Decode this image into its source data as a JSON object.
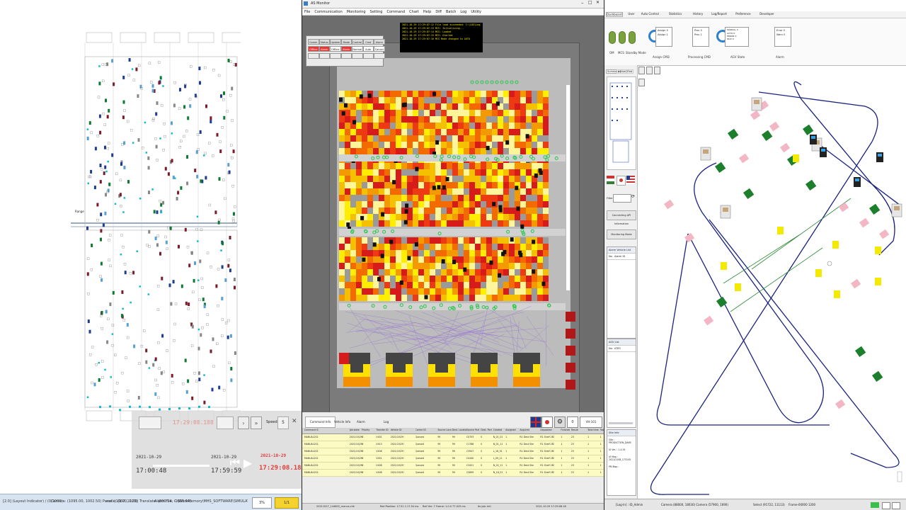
{
  "left_viewer": {
    "zoom_label": "Range",
    "playback": {
      "date_start": "2021-10-29",
      "time_start": "17:00:48",
      "date_end": "2021-10-29",
      "time_end": "17:59:59",
      "current_date": "2021-10-29",
      "current_time": "17:29:08.188",
      "speed_value": "5"
    },
    "status": {
      "item1": "[2.0] (Layout Indicator) / (0/1000)",
      "item2": "Camera: (1095.00, 1002.50) Panel: (1067, 1020)",
      "item3": "scale: (1.00, 1.00)  Translate: (800.14, -1650.04)",
      "item4": "Alarm File: C:\\WorkMemory\\MHS_SOFTWARE\\SIMULATOR\\MAP\\MAP1001_ESS\\MAP\\MAP1001_570.rdjmap",
      "zoom_pct": "3%",
      "page": "1/1"
    }
  },
  "monitor": {
    "title": "AS Monitor",
    "menu": [
      "File",
      "Communication",
      "Monitoring",
      "Setting",
      "Command",
      "Chart",
      "Help",
      "Diff",
      "Batch",
      "Log",
      "Utility"
    ],
    "log_lines": [
      "2021-10-29 17:29:07:12  File load succeeded: C:\\LOG\\Log20211029_1751_mcsscript",
      "2021-10-29 17:29:07:13  MCS: Initializing...",
      "2021-10-29 17:29:07:14  MCS: Loaded",
      "2021-10-29 17:29:07:15  MCS: Started",
      "2021-10-29 17:29:07:16  MCS Mode changed to AUTO"
    ],
    "state_headers": [
      "Comm",
      "Status",
      "Update",
      "Mode",
      "Control",
      "Cmd",
      "Alarm"
    ],
    "state_values": [
      "Offline",
      "Alarm",
      "Offline",
      "Alarm",
      "Normal",
      "Auto",
      "Cancel"
    ],
    "tabs": [
      "Command Info",
      "Vehicle Info",
      "Alarm",
      "Log"
    ],
    "table": {
      "columns": [
        "Command ID",
        "Job state",
        "Priority",
        "Transfer ID",
        "Vehicle ID",
        "Carrier ID",
        "Source Location",
        "Dest. Location",
        "Source Port",
        "Dest. Port",
        "Created",
        "Assigned",
        "Acquired",
        "Deposited",
        "Finished",
        "Result",
        "Total time",
        "Replace"
      ],
      "rows": [
        [
          "MANUAL20211029_001",
          "2021/10/29 17:28",
          "0",
          "V401",
          "2021/10/29 17:28",
          "Queued",
          "99",
          "99",
          "C0753",
          "0",
          "N_01_01",
          "1",
          "R1 Dest Shelf",
          "R1 Shelf 2B3",
          "1",
          "23",
          "1",
          "1"
        ],
        [
          "MANUAL20211029_002",
          "2021/10/29 17:28",
          "0",
          "V413",
          "2021/10/29 17:28",
          "Queued",
          "99",
          "99",
          "C1788",
          "0",
          "N_01_11",
          "1",
          "R1 Dest Shelf",
          "R1 Shelf 2B3",
          "1",
          "23",
          "1",
          "1"
        ],
        [
          "MANUAL20211029_003",
          "2021/10/29 17:28",
          "0",
          "V406",
          "2021/10/29 17:28",
          "Queued",
          "99",
          "99",
          "C3947",
          "0",
          "L_18_01",
          "1",
          "R1 Dest Shelf",
          "R1 Shelf 2B3",
          "1",
          "23",
          "1",
          "1"
        ],
        [
          "MANUAL20211029_004",
          "2021/10/29 17:28",
          "0",
          "V451",
          "2021/10/29 17:28",
          "Queued",
          "99",
          "99",
          "C0440",
          "0",
          "L_09_11",
          "1",
          "R1 Dest Shelf",
          "R1 Shelf 2B3",
          "1",
          "23",
          "1",
          "1"
        ],
        [
          "MANUAL20211029_005",
          "2021/10/29 17:28",
          "0",
          "V408",
          "2021/10/29 17:28",
          "Queued",
          "99",
          "99",
          "C3421",
          "0",
          "N_02_11",
          "1",
          "R1 Dest Shelf",
          "R1 Shelf 2B3",
          "1",
          "23",
          "1",
          "1"
        ],
        [
          "MANUAL20211029_006",
          "2021/10/29 17:28",
          "0",
          "V408",
          "2021/10/29 17:28",
          "Queued",
          "99",
          "99",
          "C2899",
          "0",
          "N_18_01",
          "1",
          "R1 Dest Shelf",
          "R1 Shelf 2B3",
          "1",
          "23",
          "1",
          "1"
        ]
      ]
    },
    "status": {
      "left": "20211027_144602_rnanvs.chk",
      "mid": "Rail Position: 17.51 1:17.54 ms",
      "mid2": "Rail Ver: 7 Frame: 1.0.0  77.025 ms",
      "right1": "Its Job: Intl",
      "right2": "2021-10-29 17:29:08.18"
    },
    "vehicle_count": "0",
    "vehicle_id": "VH-101"
  },
  "agv": {
    "tabs": [
      "Dashboard",
      "User",
      "Auto Control",
      "Statistics",
      "History",
      "Log/Report",
      "Preference",
      "Developer"
    ],
    "ribbon": {
      "orb_labels": [
        "OM",
        "MCS",
        "Standby Mode"
      ],
      "group_labels": [
        "Assign CMD",
        "Processing CMD",
        "AGV State",
        "Alarm"
      ],
      "assign_items": [
        "Assign 0",
        "Assign 1"
      ],
      "proc_items": [
        "Proc 0",
        "Proc 1"
      ],
      "state_items": [
        "MANUAL 0",
        "AUTO 0",
        "ERROR 0",
        "IDLE 0"
      ],
      "alarm_items": [
        "Error 0",
        "Warn 0"
      ]
    },
    "side": {
      "view_tabs": [
        "Summary",
        "Active",
        "Find"
      ],
      "filter_label": "Filter",
      "connect_button": "Connecting API Information",
      "mode_button": "Monitoring Mode",
      "alarm_panel": "Alarm Vehicle List",
      "alarm_col1": "No.",
      "alarm_col2": "Alarm ID",
      "agv_panel": "AGV List",
      "agv_col1": "No.",
      "agv_col2": "AT83",
      "site_title": "Site Info",
      "site_lines": [
        "Site : PRODUCTION_DA65",
        "UI Ver. : 1.4.29",
        "UI Map : 2021/1108_173145",
        "PM Map :"
      ]
    },
    "status": {
      "s1": "[Log-In] : ID_Admin",
      "s2": "Camera (88000, 18030)  Camera (57900, 1690)",
      "s3": "Select (91722, 11113)",
      "s4": "Frame-00000 1200"
    },
    "colors": {
      "track": "#1a237e",
      "pink_station": "#f3b6c5",
      "green_station": "#1b7f2c",
      "yellow_station": "#f4ea00"
    }
  }
}
